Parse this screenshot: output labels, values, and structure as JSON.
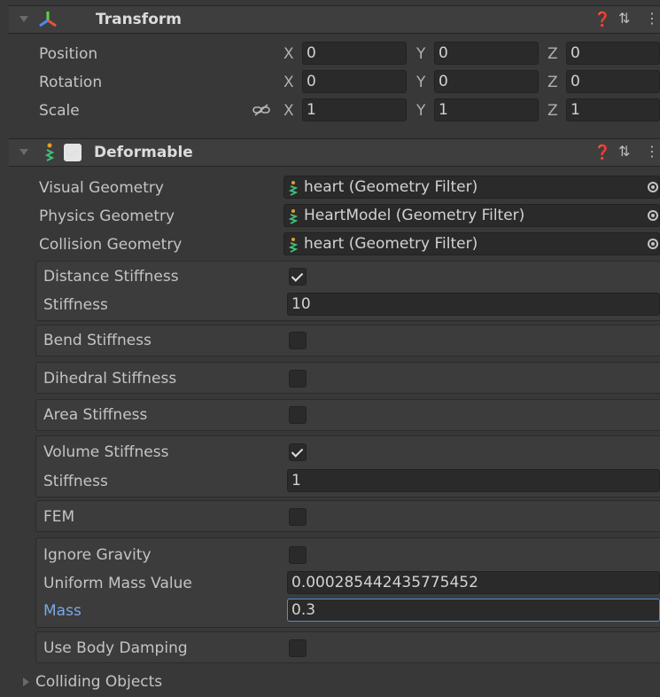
{
  "transform": {
    "title": "Transform",
    "icon": "transform-axes-icon",
    "rows": [
      {
        "label": "Position",
        "x": "0",
        "y": "0",
        "z": "0"
      },
      {
        "label": "Rotation",
        "x": "0",
        "y": "0",
        "z": "0"
      },
      {
        "label": "Scale",
        "x": "1",
        "y": "1",
        "z": "1"
      }
    ],
    "axis_x": "X",
    "axis_y": "Y",
    "axis_z": "Z"
  },
  "deformable": {
    "title": "Deformable",
    "enabled": true,
    "visual_geometry_label": "Visual Geometry",
    "visual_geometry_value": "heart (Geometry Filter)",
    "physics_geometry_label": "Physics Geometry",
    "physics_geometry_value": "HeartModel (Geometry Filter)",
    "collision_geometry_label": "Collision Geometry",
    "collision_geometry_value": "heart (Geometry Filter)",
    "distance_stiffness_label": "Distance Stiffness",
    "distance_stiffness_checked": true,
    "distance_stiffness_value_label": "Stiffness",
    "distance_stiffness_value": "10",
    "bend_stiffness_label": "Bend Stiffness",
    "dihedral_stiffness_label": "Dihedral Stiffness",
    "area_stiffness_label": "Area Stiffness",
    "volume_stiffness_label": "Volume Stiffness",
    "volume_stiffness_checked": true,
    "volume_stiffness_value_label": "Stiffness",
    "volume_stiffness_value": "1",
    "fem_label": "FEM",
    "ignore_gravity_label": "Ignore Gravity",
    "uniform_mass_label": "Uniform Mass Value",
    "uniform_mass_value": "0.000285442435775452",
    "mass_label": "Mass",
    "mass_value": "0.3",
    "use_body_damping_label": "Use Body Damping",
    "colliding_objects_label": "Colliding Objects"
  },
  "colors": {
    "accent_blue": "#79a8e6",
    "focus_border": "#4d8fd6"
  }
}
